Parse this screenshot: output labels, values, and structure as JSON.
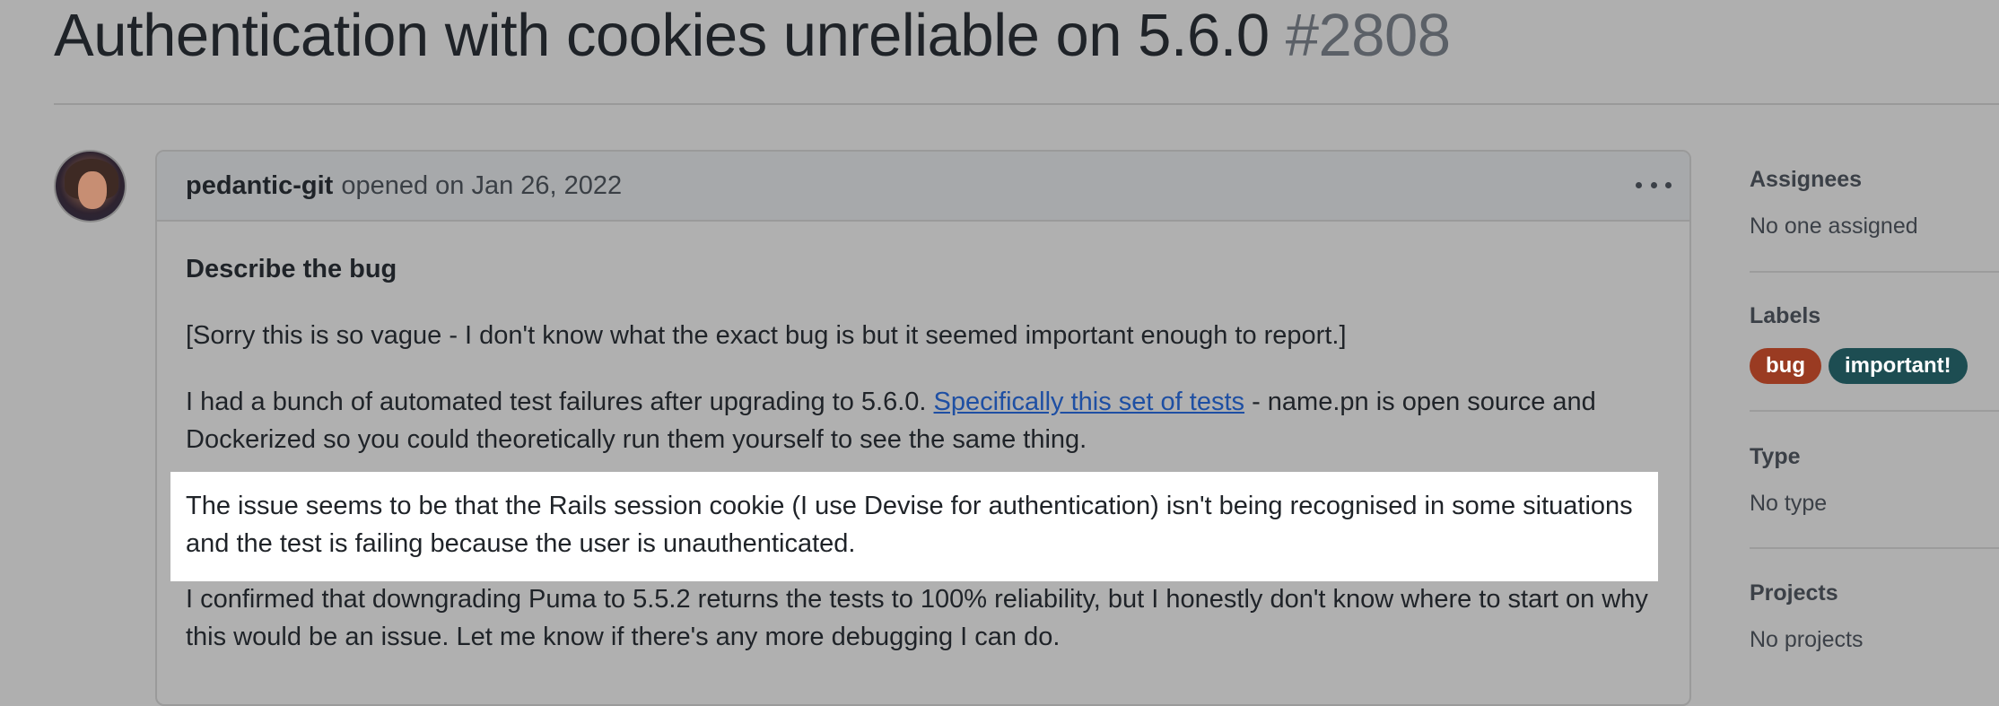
{
  "issue": {
    "title": "Authentication with cookies unreliable on 5.6.0",
    "number": "#2808"
  },
  "comment": {
    "author": "pedantic-git",
    "meta": "opened on Jan 26, 2022",
    "heading": "Describe the bug",
    "para1": "[Sorry this is so vague - I don't know what the exact bug is but it seemed important enough to report.]",
    "para2_before": "I had a bunch of automated test failures after upgrading to 5.6.0. ",
    "para2_link": "Specifically this set of tests",
    "para2_after": " - name.pn is open source and Dockerized so you could theoretically run them yourself to see the same thing.",
    "para3": "The issue seems to be that the Rails session cookie (I use Devise for authentication) isn't being recognised in some situations and the test is failing because the user is unauthenticated.",
    "para4": "I confirmed that downgrading Puma to 5.5.2 returns the tests to 100% reliability, but I honestly don't know where to start on why this would be an issue. Let me know if there's any more debugging I can do."
  },
  "sidebar": {
    "assignees_heading": "Assignees",
    "assignees_value": "No one assigned",
    "labels_heading": "Labels",
    "labels": [
      {
        "name": "bug",
        "color": "#9a3b22"
      },
      {
        "name": "important!",
        "color": "#1d4d52"
      }
    ],
    "type_heading": "Type",
    "type_value": "No type",
    "projects_heading": "Projects",
    "projects_value": "No projects"
  },
  "icons": {
    "menu": "kebab-horizontal-icon",
    "avatar": "user-avatar"
  }
}
